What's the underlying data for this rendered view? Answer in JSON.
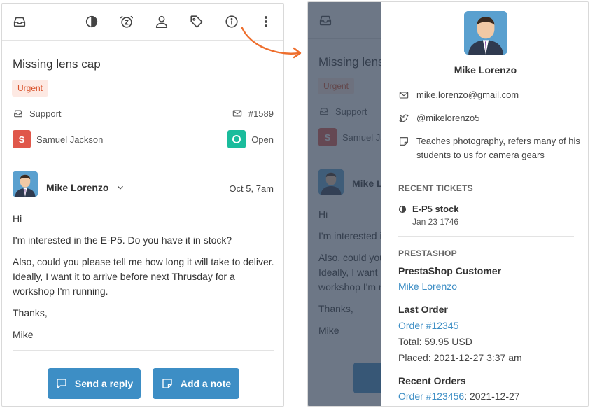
{
  "ticket": {
    "title": "Missing lens cap",
    "priority": "Urgent",
    "inbox": "Support",
    "number": "#1589",
    "assignee": "Samuel Jackson",
    "assignee_initial": "S",
    "status": "Open"
  },
  "toolbar": {
    "icons": [
      "inbox-icon",
      "contrast-icon",
      "snooze-icon",
      "user-icon",
      "tag-icon",
      "info-icon",
      "more-icon"
    ]
  },
  "message": {
    "author": "Mike Lorenzo",
    "date": "Oct 5, 7am",
    "paragraphs": [
      "Hi",
      "I'm interested in the E-P5. Do you have it in stock?",
      "Also, could you please tell me how long it will take to deliver. Ideally, I want it to arrive before next Thrusday for a workshop I'm running.",
      "Thanks,",
      "Mike"
    ]
  },
  "actions": {
    "reply": "Send a reply",
    "note": "Add a note"
  },
  "customer": {
    "name": "Mike Lorenzo",
    "email": "mike.lorenzo@gmail.com",
    "twitter": "@mikelorenzo5",
    "note": "Teaches photography, refers many of his students to us for camera gears"
  },
  "recent_tickets": {
    "heading": "RECENT TICKETS",
    "items": [
      {
        "title": "E-P5 stock",
        "meta": "Jan 23 1746"
      }
    ]
  },
  "prestashop": {
    "heading": "PRESTASHOP",
    "customer_label": "PrestaShop Customer",
    "customer_link": "Mike Lorenzo",
    "last_order_label": "Last Order",
    "last_order_link": "Order #12345",
    "total": "Total: 59.95 USD",
    "placed": "Placed: 2021-12-27 3:37 am",
    "recent_orders_label": "Recent Orders",
    "recent_order_link": "Order #123456",
    "recent_order_date": ": 2021-12-27"
  },
  "colors": {
    "accent": "#3d8ec5",
    "urgent": "#d9532c",
    "open": "#1abc9c",
    "arrow": "#ee6e2d"
  }
}
